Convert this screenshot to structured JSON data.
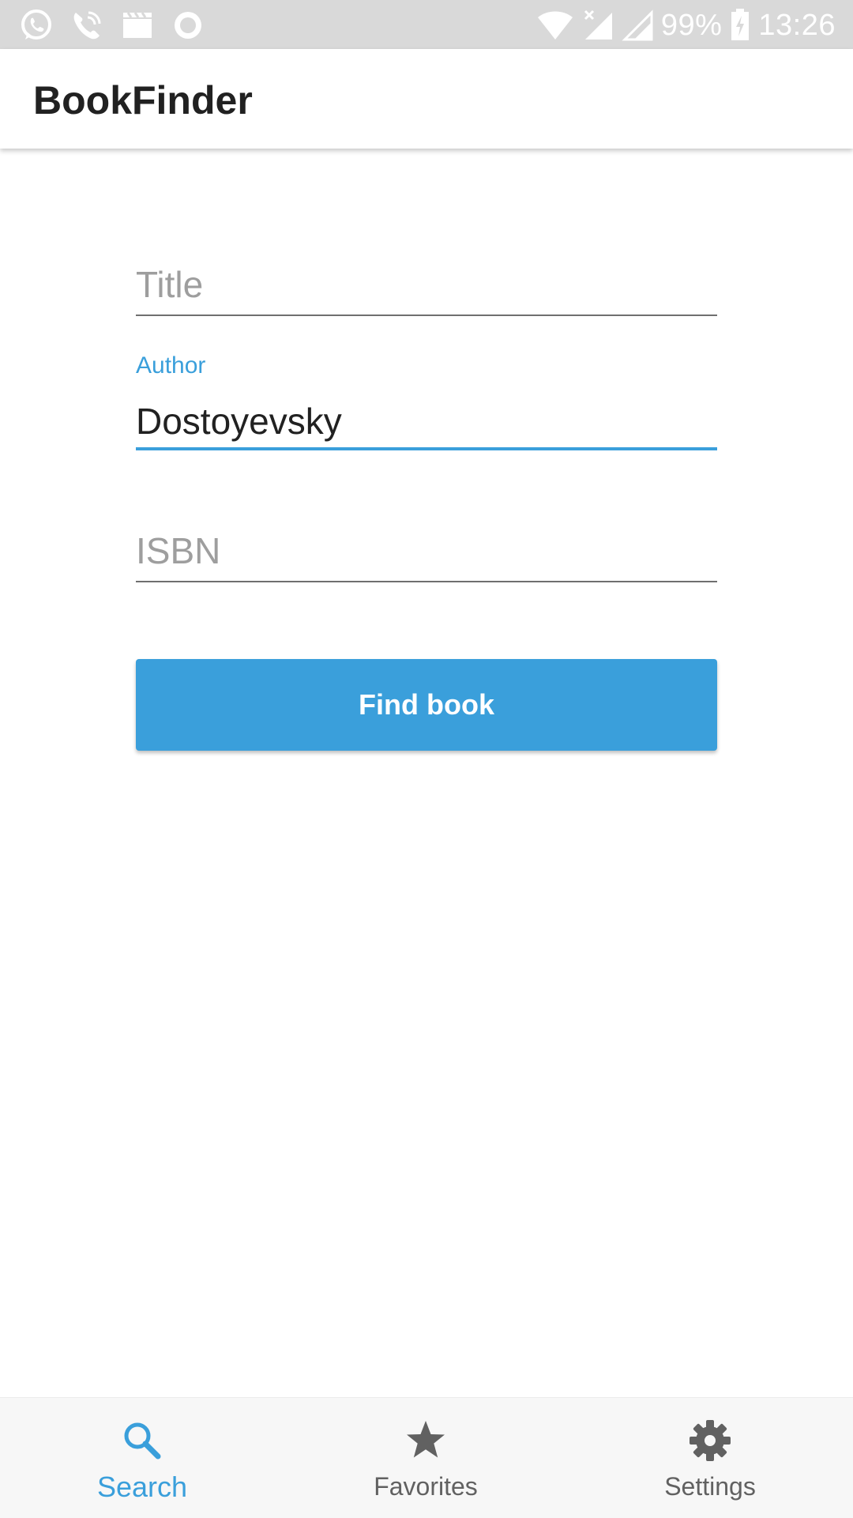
{
  "status_bar": {
    "battery_text": "99%",
    "time": "13:26",
    "left_icons": [
      "whatsapp-icon",
      "phone-call-icon",
      "clapperboard-icon",
      "record-icon"
    ],
    "right_icons": [
      "wifi-icon",
      "signal-no-data-icon",
      "signal-icon",
      "battery-charging-icon"
    ]
  },
  "app_bar": {
    "title": "BookFinder"
  },
  "form": {
    "title": {
      "placeholder": "Title",
      "value": ""
    },
    "author": {
      "label": "Author",
      "value": "Dostoyevsky"
    },
    "isbn": {
      "placeholder": "ISBN",
      "value": ""
    },
    "submit_label": "Find book"
  },
  "bottom_nav": {
    "items": [
      {
        "label": "Search",
        "icon": "search-icon",
        "active": true
      },
      {
        "label": "Favorites",
        "icon": "star-icon",
        "active": false
      },
      {
        "label": "Settings",
        "icon": "gear-icon",
        "active": false
      }
    ]
  },
  "colors": {
    "accent": "#3a9fdb",
    "status_bar": "#d9d9d9",
    "inactive": "#616161",
    "text": "#212121",
    "placeholder": "#9e9e9e"
  }
}
